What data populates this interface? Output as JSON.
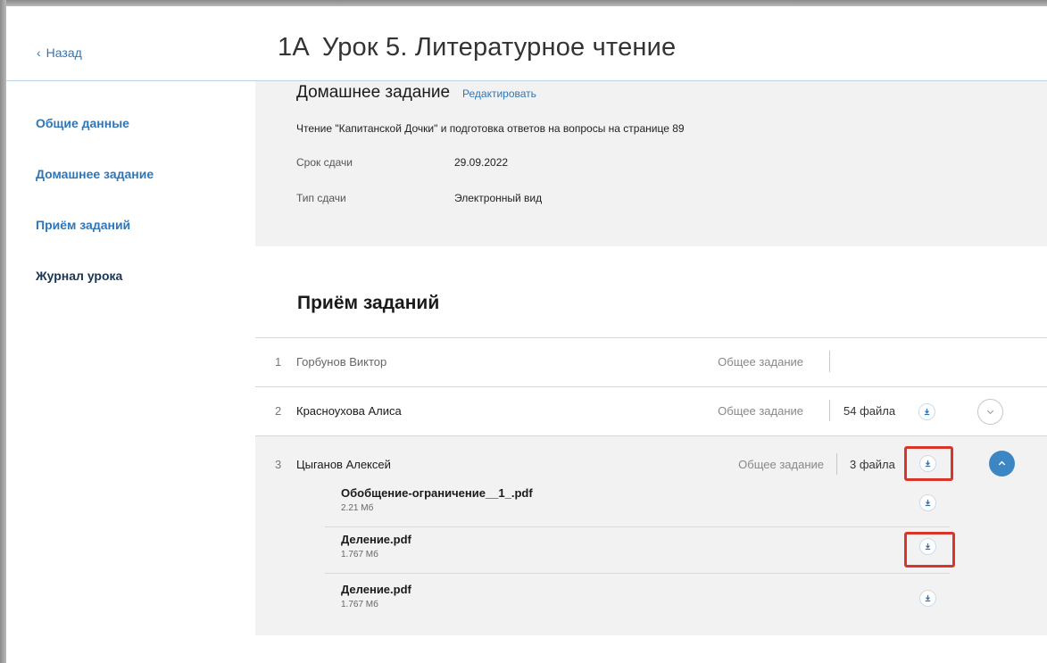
{
  "header": {
    "back_label": "Назад",
    "class_code": "1А",
    "lesson_title": "Урок 5. Литературное чтение"
  },
  "sidebar": {
    "items": [
      {
        "label": "Общие данные"
      },
      {
        "label": "Домашнее задание"
      },
      {
        "label": "Приём заданий"
      },
      {
        "label": "Журнал урока"
      }
    ]
  },
  "homework": {
    "title": "Домашнее задание",
    "edit_label": "Редактировать",
    "description": "Чтение \"Капитанской Дочки\" и подготовка ответов на вопросы на странице 89",
    "due_label": "Срок сдачи",
    "due_value": "29.09.2022",
    "type_label": "Тип сдачи",
    "type_value": "Электронный вид"
  },
  "submissions": {
    "title": "Приём заданий",
    "rows": [
      {
        "num": "1",
        "name": "Горбунов Виктор",
        "kind": "Общее задание",
        "files": ""
      },
      {
        "num": "2",
        "name": "Красноухова Алиса",
        "kind": "Общее задание",
        "files": "54 файла"
      },
      {
        "num": "3",
        "name": "Цыганов Алексей",
        "kind": "Общее задание",
        "files": "3 файла"
      }
    ],
    "expanded_files": [
      {
        "name": "Обобщение-ограничение__1_.pdf",
        "size": "2.21 Мб"
      },
      {
        "name": "Деление.pdf",
        "size": "1.767 Мб"
      },
      {
        "name": "Деление.pdf",
        "size": "1.767 Мб"
      }
    ]
  },
  "colors": {
    "accent": "#2f76b8",
    "highlight": "#d9352b",
    "panel_bg": "#f2f2f2",
    "toggle_open": "#3c86c4"
  },
  "icons": {
    "download": "download-icon",
    "toggle_closed": "chevron-down-icon",
    "toggle_open": "chevron-up-icon"
  }
}
